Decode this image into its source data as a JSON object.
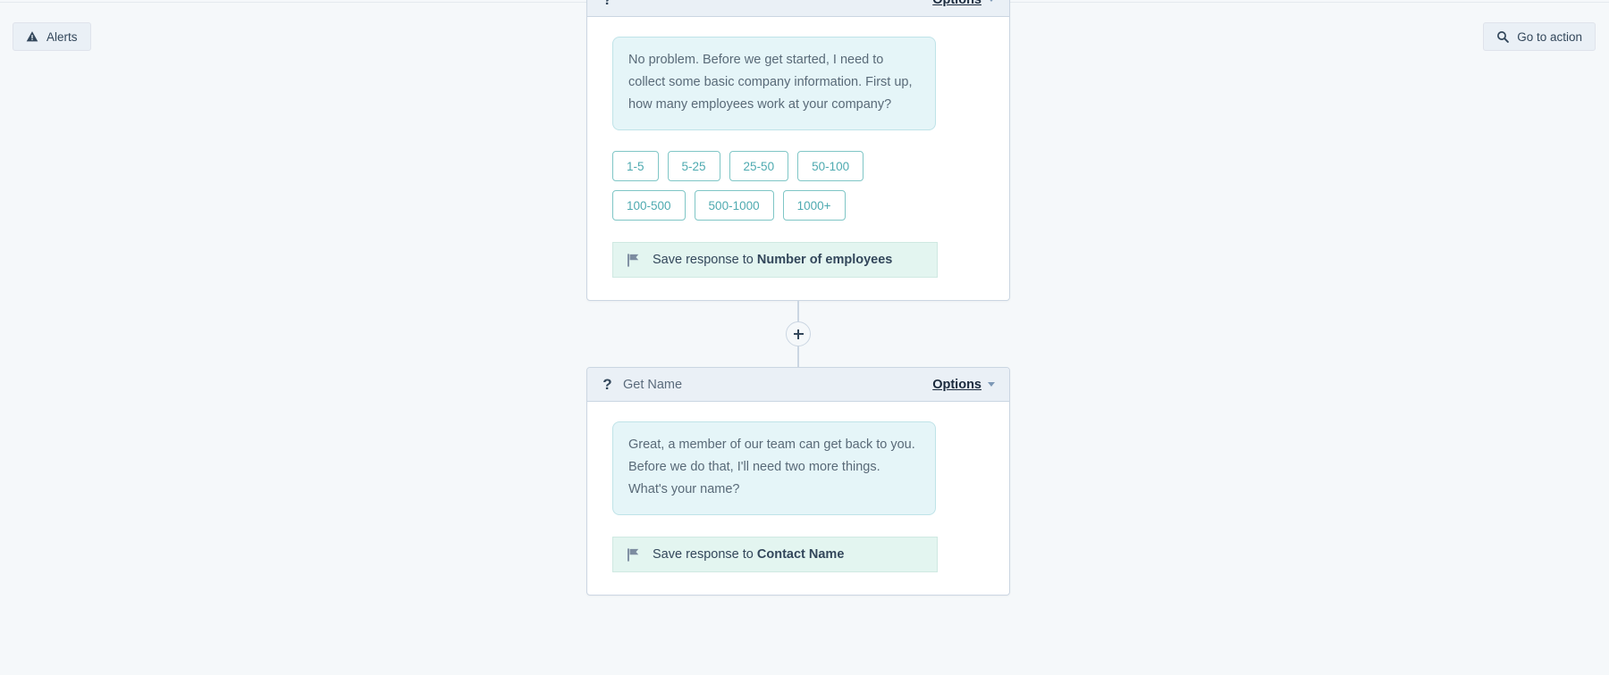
{
  "toolbar": {
    "alerts": {
      "label": "Alerts",
      "icon": "warning-triangle-icon"
    },
    "go_to_action": {
      "label": "Go to action",
      "icon": "search-icon"
    }
  },
  "flow": {
    "add_step_button": {
      "label": "+",
      "icon": "plus-icon"
    },
    "cards": [
      {
        "id": "number-of-employees",
        "clipped": true,
        "header": {
          "icon": "question-mark-icon",
          "icon_glyph": "?",
          "title": "",
          "options_label": "Options"
        },
        "bubble": "No problem. Before we get started, I need to collect some basic company information. First up, how many employees work at your company?",
        "quick_replies": [
          "1-5",
          "5-25",
          "25-50",
          "50-100",
          "100-500",
          "500-1000",
          "1000+"
        ],
        "save_response": {
          "icon": "flag-icon",
          "prefix": "Save response to",
          "property": "Number of employees"
        }
      },
      {
        "id": "get-name",
        "clipped": false,
        "header": {
          "icon": "question-mark-icon",
          "icon_glyph": "?",
          "title": "Get Name",
          "options_label": "Options"
        },
        "bubble": "Great, a member of our team can get back to you. Before we do that, I'll need two more things. What's your name?",
        "quick_replies": [],
        "save_response": {
          "icon": "flag-icon",
          "prefix": "Save response to",
          "property": "Contact Name"
        }
      }
    ]
  },
  "colors": {
    "canvas_background": "#f5f8fa",
    "card_border": "#cbd6e2",
    "card_header_background": "#eaf0f6",
    "bubble_background": "#e5f5f8",
    "bubble_border": "#bfe3e8",
    "quick_reply_accent": "#7fc6c6",
    "quick_reply_text": "#4eaab0",
    "save_response_background": "#e3f5f0",
    "text_primary": "#33475b"
  }
}
